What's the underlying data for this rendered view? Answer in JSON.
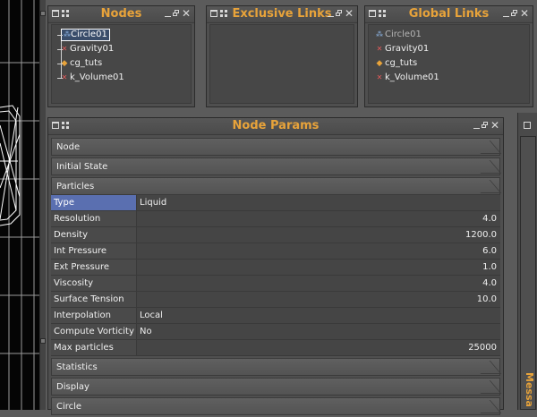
{
  "nodes_panel": {
    "title": "Nodes",
    "items": [
      {
        "label": "Circle01",
        "icon": "circle-node-icon",
        "selected": true
      },
      {
        "label": "Gravity01",
        "icon": "gravity-node-icon"
      },
      {
        "label": "cg_tuts",
        "icon": "cg-node-icon"
      },
      {
        "label": "k_Volume01",
        "icon": "volume-node-icon"
      }
    ]
  },
  "exclusive_links_panel": {
    "title": "Exclusive Links"
  },
  "global_links_panel": {
    "title": "Global Links",
    "items": [
      {
        "label": "Circle01",
        "icon": "circle-node-icon",
        "dimmed": true
      },
      {
        "label": "Gravity01",
        "icon": "gravity-node-icon"
      },
      {
        "label": "cg_tuts",
        "icon": "cg-node-icon"
      },
      {
        "label": "k_Volume01",
        "icon": "volume-node-icon"
      }
    ]
  },
  "node_params_panel": {
    "title": "Node Params",
    "sections_top": [
      "Node",
      "Initial State",
      "Particles"
    ],
    "rows": [
      {
        "label": "Type",
        "value": "Liquid",
        "selected": true
      },
      {
        "label": "Resolution",
        "value": "4.0",
        "numeric": true
      },
      {
        "label": "Density",
        "value": "1200.0",
        "numeric": true
      },
      {
        "label": "Int Pressure",
        "value": "6.0",
        "numeric": true
      },
      {
        "label": "Ext Pressure",
        "value": "1.0",
        "numeric": true
      },
      {
        "label": "Viscosity",
        "value": "4.0",
        "numeric": true
      },
      {
        "label": "Surface Tension",
        "value": "10.0",
        "numeric": true
      },
      {
        "label": "Interpolation",
        "value": "Local"
      },
      {
        "label": "Compute Vorticity",
        "value": "No"
      },
      {
        "label": "Max particles",
        "value": "25000",
        "numeric": true
      }
    ],
    "sections_bottom": [
      "Statistics",
      "Display",
      "Circle"
    ]
  },
  "messages_panel": {
    "title_partial": "Messa"
  },
  "colors": {
    "accent": "#e8a33a",
    "panel_bg": "#4f4f4f",
    "selection": "#5a6fb0",
    "viewport_bg": "#050505"
  }
}
